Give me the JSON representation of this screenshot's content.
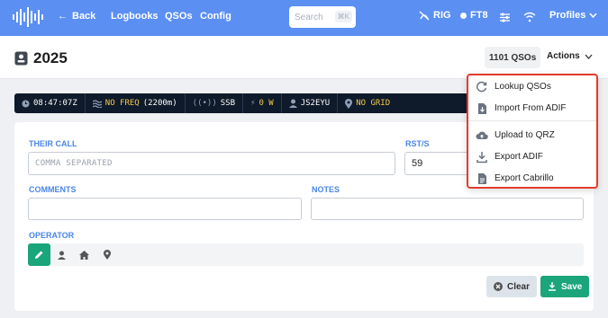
{
  "nav": {
    "back": "Back",
    "links": [
      "Logbooks",
      "QSOs",
      "Config"
    ],
    "search_placeholder": "Search",
    "search_shortcut": "⌘K",
    "rig": "RIG",
    "ft8": "FT8",
    "profiles": "Profiles"
  },
  "header": {
    "title": "2025",
    "qso_count": "1101 QSOs",
    "actions": "Actions"
  },
  "status": {
    "time": "08:47:07Z",
    "freq": "NO FREQ",
    "band": "(2200m)",
    "mode": "SSB",
    "power": "0 W",
    "callsign": "JS2EYU",
    "grid": "NO GRID"
  },
  "form": {
    "their_call_label": "THEIR CALL",
    "their_call_placeholder": "COMMA SEPARATED",
    "rst_label": "RST/S",
    "rst_value": "59",
    "comments_label": "COMMENTS",
    "notes_label": "NOTES",
    "operator_label": "OPERATOR",
    "clear": "Clear",
    "save": "Save"
  },
  "menu": {
    "items": [
      "Lookup QSOs",
      "Import From ADIF",
      "Upload to QRZ",
      "Export ADIF",
      "Export Cabrillo"
    ]
  },
  "colors": {
    "nav": "#5b8ff2",
    "accent": "#1aa57a",
    "highlight": "#e43b2c"
  }
}
